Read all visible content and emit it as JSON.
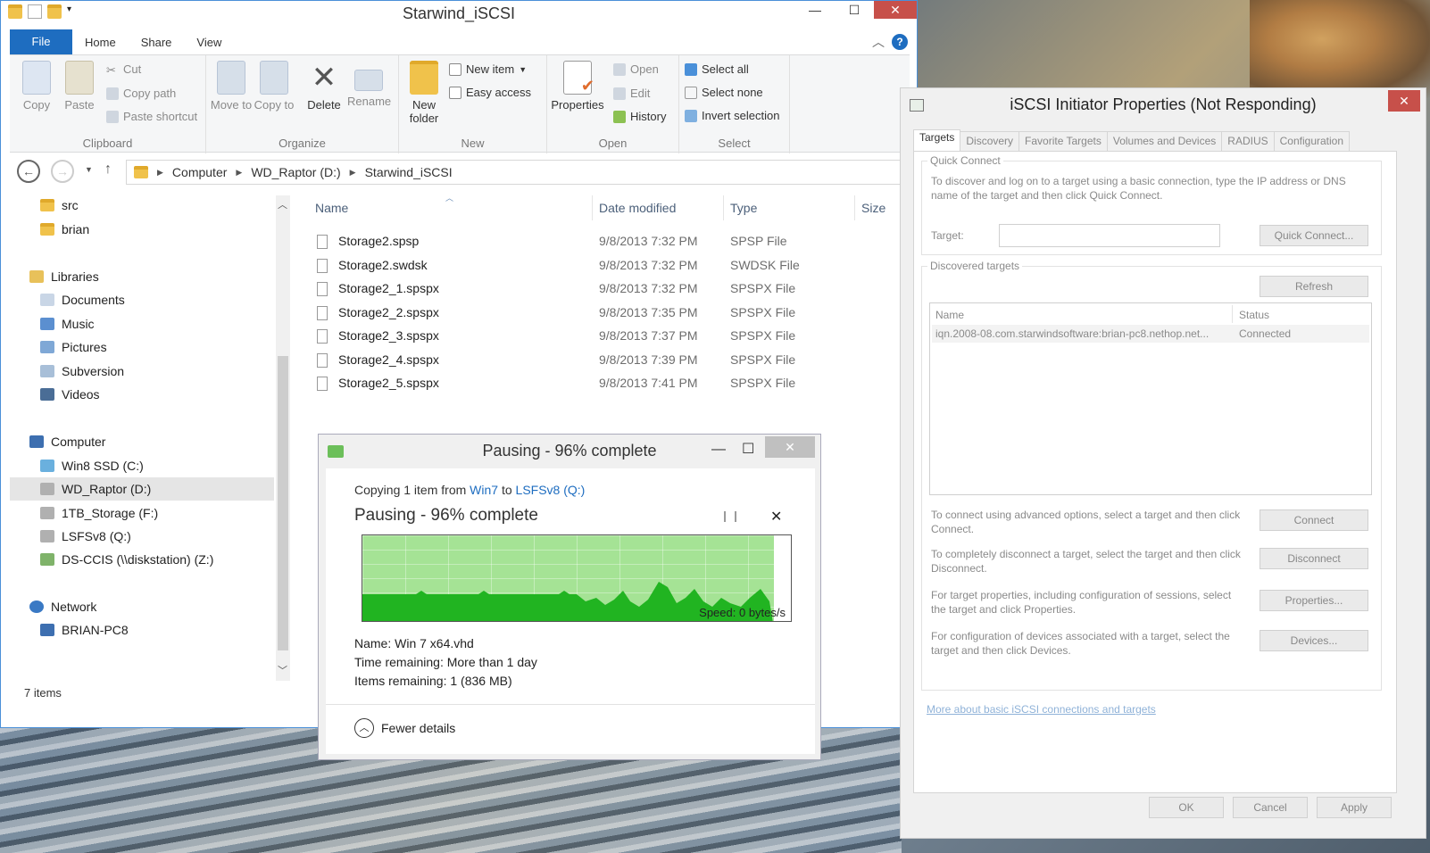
{
  "explorer": {
    "title": "Starwind_iSCSI",
    "tabs": {
      "file": "File",
      "home": "Home",
      "share": "Share",
      "view": "View"
    },
    "ribbon": {
      "clipboard": {
        "label": "Clipboard",
        "copy": "Copy",
        "paste": "Paste",
        "cut": "Cut",
        "copy_path": "Copy path",
        "paste_shortcut": "Paste shortcut"
      },
      "organize": {
        "label": "Organize",
        "move_to": "Move to",
        "copy_to": "Copy to",
        "delete": "Delete",
        "rename": "Rename"
      },
      "new": {
        "label": "New",
        "new_folder": "New folder",
        "new_item": "New item",
        "easy_access": "Easy access"
      },
      "open": {
        "label": "Open",
        "properties": "Properties",
        "open": "Open",
        "edit": "Edit",
        "history": "History"
      },
      "select": {
        "label": "Select",
        "select_all": "Select all",
        "select_none": "Select none",
        "invert_selection": "Invert selection"
      }
    },
    "address": {
      "computer": "Computer",
      "drive": "WD_Raptor (D:)",
      "folder": "Starwind_iSCSI"
    },
    "nav": {
      "src": "src",
      "brian": "brian",
      "libraries": "Libraries",
      "documents": "Documents",
      "music": "Music",
      "pictures": "Pictures",
      "subversion": "Subversion",
      "videos": "Videos",
      "computer": "Computer",
      "win8": "Win8 SSD (C:)",
      "wd": "WD_Raptor (D:)",
      "tb": "1TB_Storage (F:)",
      "lsfs": "LSFSv8 (Q:)",
      "ds": "DS-CCIS (\\\\diskstation) (Z:)",
      "network": "Network",
      "brianpc": "BRIAN-PC8"
    },
    "columns": {
      "name": "Name",
      "date": "Date modified",
      "type": "Type",
      "size": "Size"
    },
    "files": [
      {
        "name": "Storage2.spsp",
        "date": "9/8/2013 7:32 PM",
        "type": "SPSP File"
      },
      {
        "name": "Storage2.swdsk",
        "date": "9/8/2013 7:32 PM",
        "type": "SWDSK File"
      },
      {
        "name": "Storage2_1.spspx",
        "date": "9/8/2013 7:32 PM",
        "type": "SPSPX File"
      },
      {
        "name": "Storage2_2.spspx",
        "date": "9/8/2013 7:35 PM",
        "type": "SPSPX File"
      },
      {
        "name": "Storage2_3.spspx",
        "date": "9/8/2013 7:37 PM",
        "type": "SPSPX File"
      },
      {
        "name": "Storage2_4.spspx",
        "date": "9/8/2013 7:39 PM",
        "type": "SPSPX File"
      },
      {
        "name": "Storage2_5.spspx",
        "date": "9/8/2013 7:41 PM",
        "type": "SPSPX File"
      }
    ],
    "status": "7 items"
  },
  "copy": {
    "title": "Pausing - 96% complete",
    "copying_prefix": "Copying 1 item from ",
    "from": "Win7",
    "to_word": " to ",
    "to": "LSFSv8 (Q:)",
    "heading": "Pausing - 96% complete",
    "progress": 0.96,
    "speed": "Speed: 0 bytes/s",
    "name_line": "Name:  Win 7 x64.vhd",
    "time_line": "Time remaining:  More than 1 day",
    "items_line": "Items remaining:  1 (836 MB)",
    "fewer": "Fewer details"
  },
  "iscsi": {
    "title": "iSCSI Initiator Properties (Not Responding)",
    "tabs": [
      "Targets",
      "Discovery",
      "Favorite Targets",
      "Volumes and Devices",
      "RADIUS",
      "Configuration"
    ],
    "quick_connect": "Quick Connect",
    "quick_desc": "To discover and log on to a target using a basic connection, type the IP address or DNS name of the target and then click Quick Connect.",
    "target_label": "Target:",
    "target_value": "",
    "quick_btn": "Quick Connect...",
    "discovered": "Discovered targets",
    "refresh": "Refresh",
    "col_name": "Name",
    "col_status": "Status",
    "target_row": {
      "name": "iqn.2008-08.com.starwindsoftware:brian-pc8.nethop.net...",
      "status": "Connected"
    },
    "connect_desc": "To connect using advanced options, select a target and then click Connect.",
    "connect": "Connect",
    "disconnect_desc": "To completely disconnect a target, select the target and then click Disconnect.",
    "disconnect": "Disconnect",
    "properties_desc": "For target properties, including configuration of sessions, select the target and click Properties.",
    "properties": "Properties...",
    "devices_desc": "For configuration of devices associated with a target, select the target and then click Devices.",
    "devices": "Devices...",
    "more_link": "More about basic iSCSI connections and targets",
    "ok": "OK",
    "cancel": "Cancel",
    "apply": "Apply"
  }
}
